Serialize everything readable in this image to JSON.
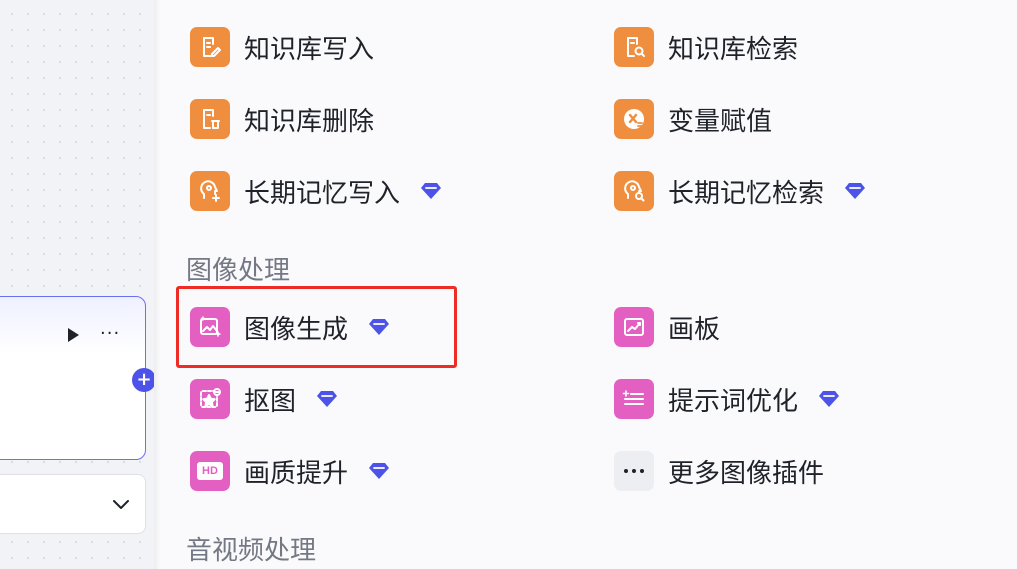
{
  "canvas": {
    "node_more_label": "···",
    "port_label": "+"
  },
  "panel": {
    "sections": {
      "image_title": "图像处理",
      "av_title": "音视频处理"
    },
    "knowledge_items": [
      {
        "label": "知识库写入",
        "icon": "knowledge-write-icon"
      },
      {
        "label": "知识库检索",
        "icon": "knowledge-search-icon"
      },
      {
        "label": "知识库删除",
        "icon": "knowledge-delete-icon"
      },
      {
        "label": "变量赋值",
        "icon": "variable-assign-icon"
      },
      {
        "label": "长期记忆写入",
        "icon": "memory-write-icon",
        "premium": true
      },
      {
        "label": "长期记忆检索",
        "icon": "memory-search-icon",
        "premium": true
      }
    ],
    "image_items": [
      {
        "label": "图像生成",
        "icon": "image-generate-icon",
        "premium": true
      },
      {
        "label": "画板",
        "icon": "canvas-board-icon"
      },
      {
        "label": "抠图",
        "icon": "cutout-icon",
        "premium": true
      },
      {
        "label": "提示词优化",
        "icon": "prompt-optimize-icon",
        "premium": true
      },
      {
        "label": "画质提升",
        "icon": "hd-upscale-icon",
        "premium": true,
        "icon_text": "HD"
      },
      {
        "label": "更多图像插件",
        "icon": "more-dots-icon"
      }
    ]
  },
  "colors": {
    "orange_icon": "#ef8e3e",
    "pink_icon": "#e45fc2",
    "premium_gem": "#4d53e8",
    "highlight_border": "#ee2b24",
    "node_border": "#6b6ff2"
  }
}
